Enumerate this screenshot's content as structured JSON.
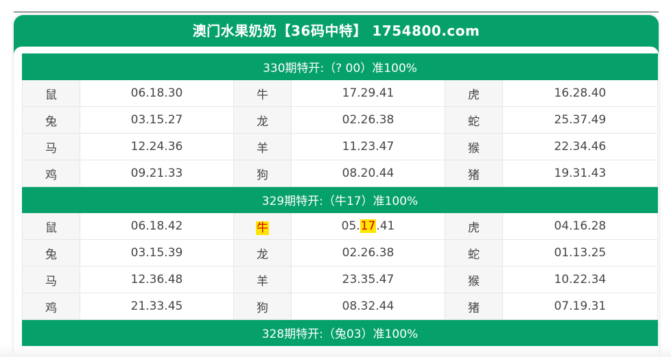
{
  "title": "澳门水果奶奶【36码中特】 1754800.com",
  "periods": [
    {
      "header": "330期特开:（? 00）准100%",
      "rows": [
        [
          {
            "z": "鼠",
            "n": "06.18.30"
          },
          {
            "z": "牛",
            "n": "17.29.41"
          },
          {
            "z": "虎",
            "n": "16.28.40"
          }
        ],
        [
          {
            "z": "兔",
            "n": "03.15.27"
          },
          {
            "z": "龙",
            "n": "02.26.38"
          },
          {
            "z": "蛇",
            "n": "25.37.49"
          }
        ],
        [
          {
            "z": "马",
            "n": "12.24.36"
          },
          {
            "z": "羊",
            "n": "11.23.47"
          },
          {
            "z": "猴",
            "n": "22.34.46"
          }
        ],
        [
          {
            "z": "鸡",
            "n": "09.21.33"
          },
          {
            "z": "狗",
            "n": "08.20.44"
          },
          {
            "z": "猪",
            "n": "19.31.43"
          }
        ]
      ]
    },
    {
      "header": "329期特开:（牛17）准100%",
      "rows": [
        [
          {
            "z": "鼠",
            "n": "06.18.42"
          },
          {
            "z": "牛",
            "n_pre": "05.",
            "n_hl": "17",
            "n_post": ".41",
            "hit": true
          },
          {
            "z": "虎",
            "n": "04.16.28"
          }
        ],
        [
          {
            "z": "兔",
            "n": "03.15.39"
          },
          {
            "z": "龙",
            "n": "02.26.38"
          },
          {
            "z": "蛇",
            "n": "01.13.25"
          }
        ],
        [
          {
            "z": "马",
            "n": "12.36.48"
          },
          {
            "z": "羊",
            "n": "23.35.47"
          },
          {
            "z": "猴",
            "n": "10.22.34"
          }
        ],
        [
          {
            "z": "鸡",
            "n": "21.33.45"
          },
          {
            "z": "狗",
            "n": "08.32.44"
          },
          {
            "z": "猪",
            "n": "07.19.31"
          }
        ]
      ]
    },
    {
      "header": "328期特开:（兔03）准100%"
    }
  ],
  "colors": {
    "accent": "#06a16b",
    "highlight_bg": "#ffe500",
    "highlight_text": "#d40000"
  }
}
